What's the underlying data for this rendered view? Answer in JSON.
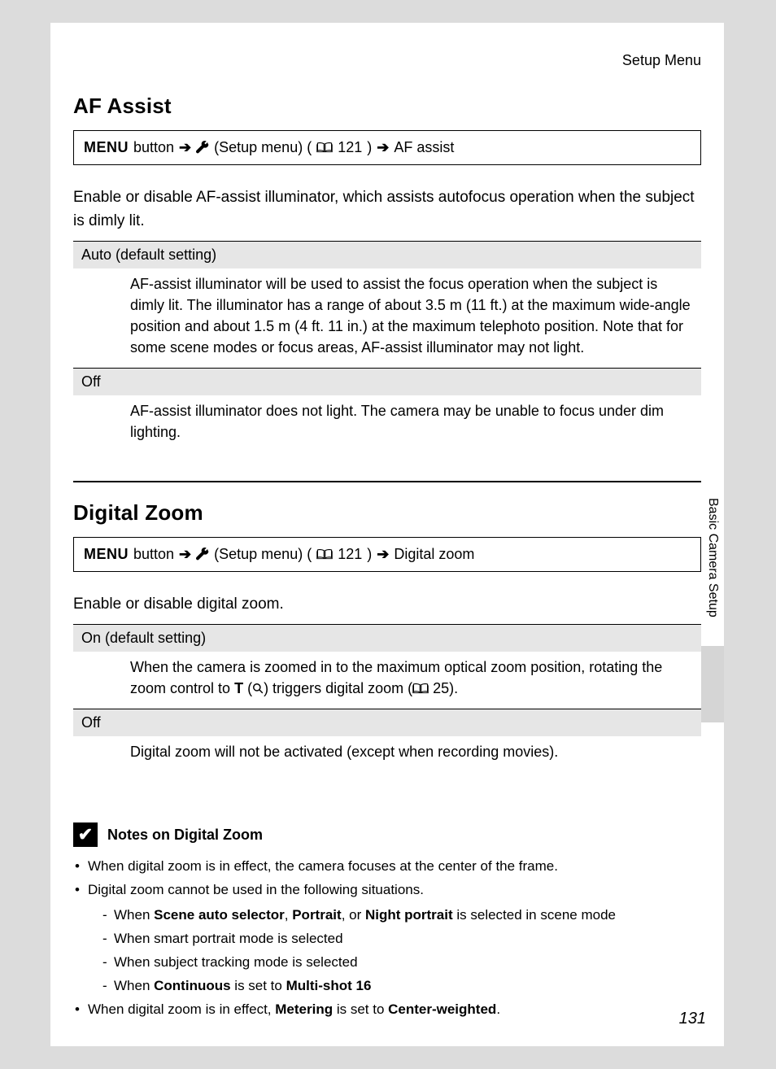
{
  "header": {
    "menu_label": "Setup Menu"
  },
  "side": {
    "label": "Basic Camera Setup"
  },
  "page_number": "131",
  "nav": {
    "menu_word": "MENU",
    "button_word": "button",
    "setup_text": "(Setup menu) (",
    "close_paren": ")"
  },
  "sections": [
    {
      "id": "af",
      "title": "AF Assist",
      "page_ref": "121",
      "dest": "AF assist",
      "intro": "Enable or disable AF-assist illuminator, which assists autofocus operation when the subject is dimly lit.",
      "options": [
        {
          "name": "Auto (default setting)",
          "desc": "AF-assist illuminator will be used to assist the focus operation when the subject is dimly lit. The illuminator has a range of about 3.5 m (11 ft.) at the maximum wide-angle position and about 1.5 m (4 ft. 11 in.) at the maximum telephoto position. Note that for some scene modes or focus areas, AF-assist illuminator may not light."
        },
        {
          "name": "Off",
          "desc": "AF-assist illuminator does not light. The camera may be unable to focus under dim lighting."
        }
      ]
    },
    {
      "id": "dz",
      "title": "Digital Zoom",
      "page_ref": "121",
      "dest": "Digital zoom",
      "intro": "Enable or disable digital zoom.",
      "options": [
        {
          "name": "On (default setting)",
          "desc_pre": "When the camera is zoomed in to the maximum optical zoom position, rotating the zoom control to ",
          "t_letter": "T",
          "desc_mid": ") triggers digital zoom (",
          "page_ref2": "25",
          "desc_post": ")."
        },
        {
          "name": "Off",
          "desc": "Digital zoom will not be activated (except when recording movies)."
        }
      ]
    }
  ],
  "notes": {
    "title": "Notes on Digital Zoom",
    "bullets": {
      "b1": "When digital zoom is in effect, the camera focuses at the center of the frame.",
      "b2": "Digital zoom cannot be used in the following situations.",
      "s1_pre": "When ",
      "s1_a": "Scene auto selector",
      "s1_comma": ", ",
      "s1_b": "Portrait",
      "s1_or": ", or ",
      "s1_c": "Night portrait",
      "s1_post": " is selected in scene mode",
      "s2": "When smart portrait mode is selected",
      "s3": "When subject tracking mode is selected",
      "s4_pre": "When ",
      "s4_a": "Continuous",
      "s4_mid": " is set to ",
      "s4_b": "Multi-shot 16",
      "b3_pre": "When digital zoom is in effect, ",
      "b3_a": "Metering",
      "b3_mid": " is set to ",
      "b3_b": "Center-weighted",
      "b3_post": "."
    }
  }
}
